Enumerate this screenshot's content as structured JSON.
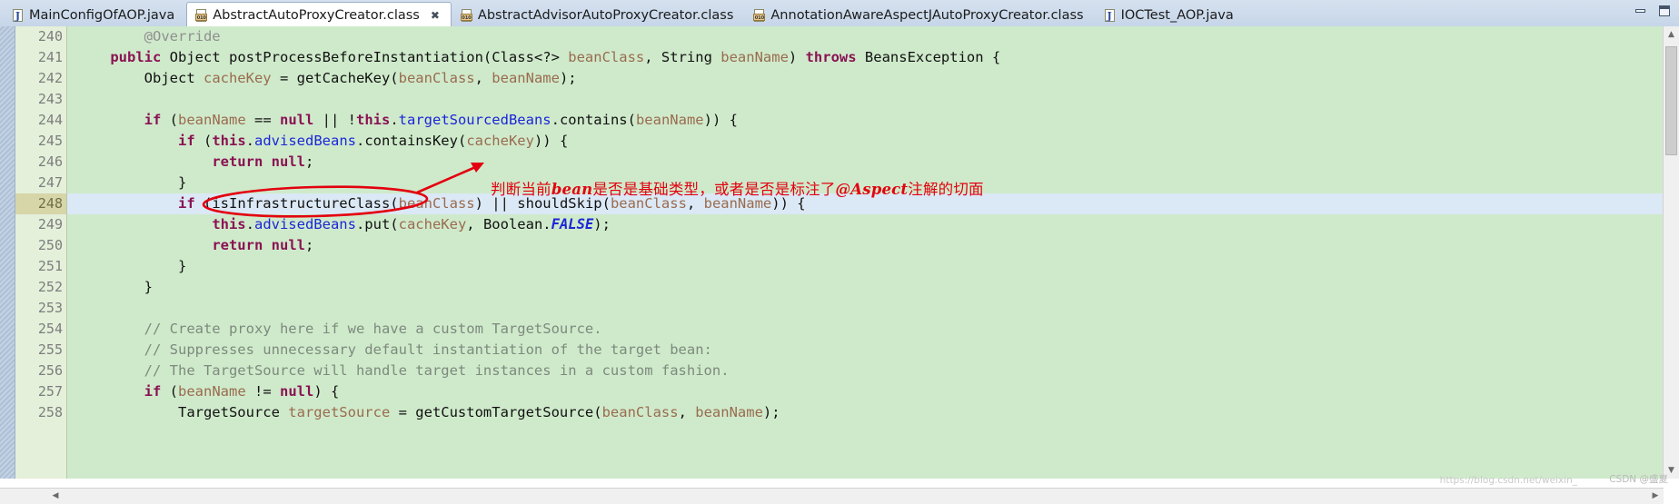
{
  "window": {
    "minimize_label": "minimize",
    "maximize_label": "maximize"
  },
  "tabs": [
    {
      "label": "MainConfigOfAOP.java",
      "icon": "java-file-icon",
      "active": false,
      "closable": false
    },
    {
      "label": "AbstractAutoProxyCreator.class",
      "icon": "class-file-icon",
      "active": true,
      "closable": true,
      "close_glyph": "✖"
    },
    {
      "label": "AbstractAdvisorAutoProxyCreator.class",
      "icon": "class-file-icon",
      "active": false,
      "closable": false
    },
    {
      "label": "AnnotationAwareAspectJAutoProxyCreator.class",
      "icon": "class-file-icon",
      "active": false,
      "closable": false
    },
    {
      "label": "IOCTest_AOP.java",
      "icon": "java-file-icon",
      "active": false,
      "closable": false
    }
  ],
  "editor": {
    "highlighted_line": 248,
    "first_line": 240,
    "last_line": 258,
    "colors": {
      "background": "#cfeacb",
      "line_number_background": "#e4f0da",
      "highlight_line_background": "#dbe8f5",
      "highlight_number_background": "#d6d6a8",
      "keyword": "#8a1253",
      "field": "#1c26d8",
      "parameter": "#9a6b4f",
      "comment": "#7d8a7d",
      "annotation": "#8f8f8f",
      "annotation_red": "#e3000f"
    },
    "lines": [
      {
        "n": "240",
        "fold": true,
        "override": false,
        "tokens": [
          {
            "t": "        ",
            "c": "plain"
          },
          {
            "t": "@Override",
            "c": "ann"
          }
        ]
      },
      {
        "n": "241",
        "fold": false,
        "override": true,
        "tokens": [
          {
            "t": "    ",
            "c": "plain"
          },
          {
            "t": "public",
            "c": "kw"
          },
          {
            "t": " Object postProcessBeforeInstantiation(Class<?> ",
            "c": "plain"
          },
          {
            "t": "beanClass",
            "c": "par"
          },
          {
            "t": ", String ",
            "c": "plain"
          },
          {
            "t": "beanName",
            "c": "par"
          },
          {
            "t": ") ",
            "c": "plain"
          },
          {
            "t": "throws",
            "c": "kw"
          },
          {
            "t": " BeansException {",
            "c": "plain"
          }
        ]
      },
      {
        "n": "242",
        "fold": false,
        "override": false,
        "tokens": [
          {
            "t": "        Object ",
            "c": "plain"
          },
          {
            "t": "cacheKey",
            "c": "par"
          },
          {
            "t": " = getCacheKey(",
            "c": "plain"
          },
          {
            "t": "beanClass",
            "c": "par"
          },
          {
            "t": ", ",
            "c": "plain"
          },
          {
            "t": "beanName",
            "c": "par"
          },
          {
            "t": ");",
            "c": "plain"
          }
        ]
      },
      {
        "n": "243",
        "fold": false,
        "override": false,
        "tokens": [
          {
            "t": "",
            "c": "plain"
          }
        ]
      },
      {
        "n": "244",
        "fold": false,
        "override": false,
        "tokens": [
          {
            "t": "        ",
            "c": "plain"
          },
          {
            "t": "if",
            "c": "kw"
          },
          {
            "t": " (",
            "c": "plain"
          },
          {
            "t": "beanName",
            "c": "par"
          },
          {
            "t": " == ",
            "c": "plain"
          },
          {
            "t": "null",
            "c": "kw"
          },
          {
            "t": " || !",
            "c": "plain"
          },
          {
            "t": "this",
            "c": "kw"
          },
          {
            "t": ".",
            "c": "plain"
          },
          {
            "t": "targetSourcedBeans",
            "c": "fld"
          },
          {
            "t": ".contains(",
            "c": "plain"
          },
          {
            "t": "beanName",
            "c": "par"
          },
          {
            "t": ")) {",
            "c": "plain"
          }
        ]
      },
      {
        "n": "245",
        "fold": false,
        "override": false,
        "tokens": [
          {
            "t": "            ",
            "c": "plain"
          },
          {
            "t": "if",
            "c": "kw"
          },
          {
            "t": " (",
            "c": "plain"
          },
          {
            "t": "this",
            "c": "kw"
          },
          {
            "t": ".",
            "c": "plain"
          },
          {
            "t": "advisedBeans",
            "c": "fld"
          },
          {
            "t": ".containsKey(",
            "c": "plain"
          },
          {
            "t": "cacheKey",
            "c": "par"
          },
          {
            "t": ")) {",
            "c": "plain"
          }
        ]
      },
      {
        "n": "246",
        "fold": false,
        "override": false,
        "tokens": [
          {
            "t": "                ",
            "c": "plain"
          },
          {
            "t": "return",
            "c": "kw"
          },
          {
            "t": " ",
            "c": "plain"
          },
          {
            "t": "null",
            "c": "kw"
          },
          {
            "t": ";",
            "c": "plain"
          }
        ]
      },
      {
        "n": "247",
        "fold": false,
        "override": false,
        "tokens": [
          {
            "t": "            }",
            "c": "plain"
          }
        ]
      },
      {
        "n": "248",
        "fold": false,
        "override": false,
        "highlight": true,
        "tokens": [
          {
            "t": "            ",
            "c": "plain"
          },
          {
            "t": "if",
            "c": "kw"
          },
          {
            "t": " (isInfrastructureClass(",
            "c": "plain"
          },
          {
            "t": "beanClass",
            "c": "par"
          },
          {
            "t": ") || shouldSkip(",
            "c": "plain"
          },
          {
            "t": "beanClass",
            "c": "par"
          },
          {
            "t": ", ",
            "c": "plain"
          },
          {
            "t": "beanName",
            "c": "par"
          },
          {
            "t": ")) {",
            "c": "plain"
          }
        ]
      },
      {
        "n": "249",
        "fold": false,
        "override": false,
        "tokens": [
          {
            "t": "                ",
            "c": "plain"
          },
          {
            "t": "this",
            "c": "kw"
          },
          {
            "t": ".",
            "c": "plain"
          },
          {
            "t": "advisedBeans",
            "c": "fld"
          },
          {
            "t": ".put(",
            "c": "plain"
          },
          {
            "t": "cacheKey",
            "c": "par"
          },
          {
            "t": ", Boolean.",
            "c": "plain"
          },
          {
            "t": "FALSE",
            "c": "sfld"
          },
          {
            "t": ");",
            "c": "plain"
          }
        ]
      },
      {
        "n": "250",
        "fold": false,
        "override": false,
        "tokens": [
          {
            "t": "                ",
            "c": "plain"
          },
          {
            "t": "return",
            "c": "kw"
          },
          {
            "t": " ",
            "c": "plain"
          },
          {
            "t": "null",
            "c": "kw"
          },
          {
            "t": ";",
            "c": "plain"
          }
        ]
      },
      {
        "n": "251",
        "fold": false,
        "override": false,
        "tokens": [
          {
            "t": "            }",
            "c": "plain"
          }
        ]
      },
      {
        "n": "252",
        "fold": false,
        "override": false,
        "tokens": [
          {
            "t": "        }",
            "c": "plain"
          }
        ]
      },
      {
        "n": "253",
        "fold": false,
        "override": false,
        "tokens": [
          {
            "t": "",
            "c": "plain"
          }
        ]
      },
      {
        "n": "254",
        "fold": false,
        "override": false,
        "tokens": [
          {
            "t": "        ",
            "c": "plain"
          },
          {
            "t": "// Create proxy here if we have a custom TargetSource.",
            "c": "cmt"
          }
        ]
      },
      {
        "n": "255",
        "fold": false,
        "override": false,
        "tokens": [
          {
            "t": "        ",
            "c": "plain"
          },
          {
            "t": "// Suppresses unnecessary default instantiation of the target bean:",
            "c": "cmt"
          }
        ]
      },
      {
        "n": "256",
        "fold": false,
        "override": false,
        "tokens": [
          {
            "t": "        ",
            "c": "plain"
          },
          {
            "t": "// The TargetSource will handle target instances in a custom fashion.",
            "c": "cmt"
          }
        ]
      },
      {
        "n": "257",
        "fold": false,
        "override": false,
        "tokens": [
          {
            "t": "        ",
            "c": "plain"
          },
          {
            "t": "if",
            "c": "kw"
          },
          {
            "t": " (",
            "c": "plain"
          },
          {
            "t": "beanName",
            "c": "par"
          },
          {
            "t": " != ",
            "c": "plain"
          },
          {
            "t": "null",
            "c": "kw"
          },
          {
            "t": ") {",
            "c": "plain"
          }
        ]
      },
      {
        "n": "258",
        "fold": false,
        "override": false,
        "clipped": true,
        "tokens": [
          {
            "t": "            TargetSource ",
            "c": "plain"
          },
          {
            "t": "targetSource",
            "c": "par"
          },
          {
            "t": " = getCustomTargetSource(",
            "c": "plain"
          },
          {
            "t": "beanClass",
            "c": "par"
          },
          {
            "t": ", ",
            "c": "plain"
          },
          {
            "t": "beanName",
            "c": "par"
          },
          {
            "t": ");",
            "c": "plain"
          }
        ]
      }
    ]
  },
  "annotation": {
    "text_prefix": "判断当前",
    "text_emphasis1": "bean",
    "text_middle": "是否是基础类型，或者是否是标注了",
    "text_emphasis2": "@Aspect",
    "text_suffix": "注解的切面",
    "color": "#e3000f"
  },
  "scroll": {
    "up_arrow": "▲",
    "down_arrow": "▼",
    "left_arrow": "◀",
    "right_arrow": "▶"
  },
  "watermark": {
    "url": "https://blog.csdn.net/weixin_",
    "label": "CSDN @盛夏"
  }
}
